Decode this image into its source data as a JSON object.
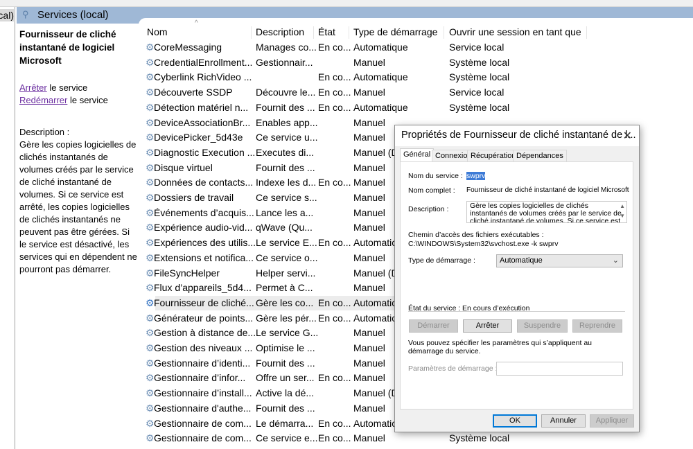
{
  "tree": {
    "item": "Services (local)"
  },
  "header": {
    "title": "Services (local)"
  },
  "left_pane": {
    "title": "Fournisseur de cliché instantané de logiciel Microsoft",
    "stop_link": "Arrêter",
    "stop_suffix": " le service",
    "restart_link": "Redémarrer",
    "restart_suffix": " le service",
    "desc_label": "Description :",
    "desc_text": "Gère les copies logicielles de clichés instantanés de volumes créés par le service de cliché instantané de volumes. Si ce service est arrêté, les copies logicielles de clichés instantanés ne peuvent pas être gérées. Si le service est désactivé, les services qui en dépendent ne pourront pas démarrer."
  },
  "columns": [
    "Nom",
    "Description",
    "État",
    "Type de démarrage",
    "Ouvrir une session en tant que"
  ],
  "rows": [
    [
      "CoreMessaging",
      "Manages co...",
      "En co...",
      "Automatique",
      "Service local"
    ],
    [
      "CredentialEnrollment...",
      "Gestionnair...",
      "",
      "Manuel",
      "Système local"
    ],
    [
      "Cyberlink RichVideo ...",
      "",
      "En co...",
      "Automatique",
      "Système local"
    ],
    [
      "Découverte SSDP",
      "Découvre le...",
      "En co...",
      "Manuel",
      "Service local"
    ],
    [
      "Détection matériel n...",
      "Fournit des ...",
      "En co...",
      "Automatique",
      "Système local"
    ],
    [
      "DeviceAssociationBr...",
      "Enables app...",
      "",
      "Manuel",
      ""
    ],
    [
      "DevicePicker_5d43e",
      "Ce service u...",
      "",
      "Manuel",
      ""
    ],
    [
      "Diagnostic Execution ...",
      "Executes di...",
      "",
      "Manuel (D",
      ""
    ],
    [
      "Disque virtuel",
      "Fournit des ...",
      "",
      "Manuel",
      ""
    ],
    [
      "Données de contacts...",
      "Indexe les d...",
      "En co...",
      "Manuel",
      ""
    ],
    [
      "Dossiers de travail",
      "Ce service s...",
      "",
      "Manuel",
      ""
    ],
    [
      "Événements d’acquis...",
      "Lance les a...",
      "",
      "Manuel",
      ""
    ],
    [
      "Expérience audio-vid...",
      "qWave (Qu...",
      "",
      "Manuel",
      ""
    ],
    [
      "Expériences des utilis...",
      "Le service E...",
      "En co...",
      "Automatic",
      ""
    ],
    [
      "Extensions et notifica...",
      "Ce service o...",
      "",
      "Manuel",
      ""
    ],
    [
      "FileSyncHelper",
      "Helper servi...",
      "",
      "Manuel (D",
      ""
    ],
    [
      "Flux d’appareils_5d4...",
      "Permet à C...",
      "",
      "Manuel",
      ""
    ],
    [
      "Fournisseur de cliché...",
      "Gère les co...",
      "En co...",
      "Automatic",
      ""
    ],
    [
      "Générateur de points...",
      "Gère les pér...",
      "En co...",
      "Automatic",
      ""
    ],
    [
      "Gestion à distance de...",
      "Le service G...",
      "",
      "Manuel",
      ""
    ],
    [
      "Gestion des niveaux ...",
      "Optimise le ...",
      "",
      "Manuel",
      ""
    ],
    [
      "Gestionnaire d’identi...",
      "Fournit des ...",
      "",
      "Manuel",
      ""
    ],
    [
      "Gestionnaire d’infor...",
      "Offre un ser...",
      "En co...",
      "Manuel",
      ""
    ],
    [
      "Gestionnaire d’install...",
      "Active la dé...",
      "",
      "Manuel (D",
      ""
    ],
    [
      "Gestionnaire d'authe...",
      "Fournit des ...",
      "",
      "Manuel",
      ""
    ],
    [
      "Gestionnaire de com...",
      "Le démarra...",
      "En co...",
      "Automatic",
      ""
    ],
    [
      "Gestionnaire de com...",
      "Ce service e...",
      "En co...",
      "Manuel",
      "Système local"
    ]
  ],
  "dialog": {
    "title": "Propriétés de Fournisseur de cliché instantané de l...",
    "tabs": [
      "Général",
      "Connexion",
      "Récupération",
      "Dépendances"
    ],
    "service_name_label": "Nom du service :",
    "service_name": "swprv",
    "full_name_label": "Nom complet :",
    "full_name": "Fournisseur de cliché instantané de logiciel Microsoft",
    "desc_label": "Description :",
    "desc": "Gère les copies logicielles de clichés instantanés de volumes créés par le service de cliché instantané de volumes. Si ce service est arrêté, les",
    "path_label": "Chemin d’accès des fichiers exécutables :",
    "path": "C:\\WINDOWS\\System32\\svchost.exe -k swprv",
    "startup_label": "Type de démarrage :",
    "startup_value": "Automatique",
    "status_label": "État du service :",
    "status": "En cours d’exécution",
    "btn_start": "Démarrer",
    "btn_stop": "Arrêter",
    "btn_pause": "Suspendre",
    "btn_resume": "Reprendre",
    "params_hint": "Vous pouvez spécifier les paramètres qui s’appliquent au démarrage du service.",
    "params_label": "Paramètres de démarrage :",
    "params_value": "",
    "ok": "OK",
    "cancel": "Annuler",
    "apply": "Appliquer"
  }
}
